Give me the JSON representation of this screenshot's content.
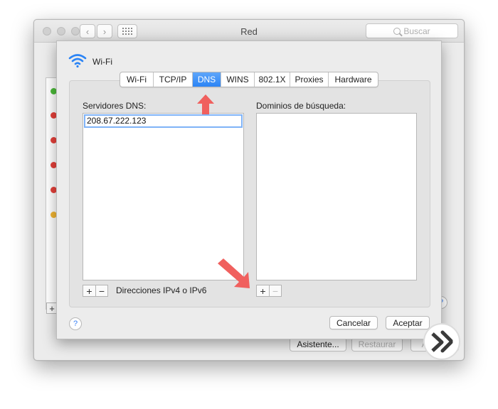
{
  "window": {
    "title": "Red",
    "search_placeholder": "Buscar",
    "nav_back": "‹",
    "nav_forward": "›",
    "bg_add": "+",
    "bg_help": "?",
    "bg_buttons": [
      "Asistente...",
      "Restaurar",
      "Aplicar"
    ]
  },
  "status_colors": [
    "#4cbb3a",
    "#e5413b",
    "#e5413b",
    "#e5413b",
    "#e5413b",
    "#f2b634"
  ],
  "sheet": {
    "title": "Wi-Fi",
    "icon": "wifi-icon",
    "tabs": [
      {
        "label": "Wi-Fi",
        "active": false
      },
      {
        "label": "TCP/IP",
        "active": false
      },
      {
        "label": "DNS",
        "active": true
      },
      {
        "label": "WINS",
        "active": false
      },
      {
        "label": "802.1X",
        "active": false
      },
      {
        "label": "Proxies",
        "active": false
      },
      {
        "label": "Hardware",
        "active": false
      }
    ],
    "dns_servers_label": "Servidores DNS:",
    "dns_servers": [
      "208.67.222.123"
    ],
    "search_domains_label": "Dominios de búsqueda:",
    "search_domains": [],
    "add_label": "+",
    "remove_label": "−",
    "dns_hint": "Direcciones IPv4 o IPv6",
    "help": "?",
    "cancel_label": "Cancelar",
    "accept_label": "Aceptar"
  },
  "accent_color": "#2b84f5",
  "annotation_arrow_color": "#f0605e"
}
